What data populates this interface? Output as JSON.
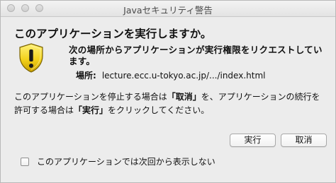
{
  "window": {
    "title": "Javaセキュリティ警告"
  },
  "dialog": {
    "heading": "このアプリケーションを実行しますか。",
    "message": "次の場所からアプリケーションが実行権限をリクエストしています。",
    "location_label": "場所:",
    "location_value": "lecture.ecc.u-tokyo.ac.jp/.../index.html",
    "info_part1": "このアプリケーションを停止する場合は",
    "info_cancel": "「取消」",
    "info_part2": "を、アプリケーションの続行を許可する場合は",
    "info_run": "「実行」",
    "info_part3": "をクリックしてください。",
    "icon": "warning-shield-icon"
  },
  "buttons": {
    "run_label": "実行",
    "cancel_label": "取消"
  },
  "checkbox": {
    "label": "このアプリケーションでは次回から表示しない",
    "checked": false
  }
}
